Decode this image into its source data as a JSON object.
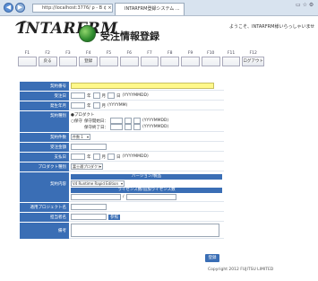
{
  "browser": {
    "address": "http://localhost:3776/",
    "address_suffix": "ρ - B ¢ ×",
    "tab_title": "INTARFRM登録システム ...",
    "tab_close": "×",
    "win_controls": "▭ ☆ ⚙"
  },
  "header": {
    "logo": "INTARFRM",
    "page_title": "受注情報登録",
    "welcome": "ようこそ、INTARFRM様いらっしゃいませ"
  },
  "fkeys": [
    {
      "key": "F1",
      "label": ""
    },
    {
      "key": "F2",
      "label": "戻る"
    },
    {
      "key": "F3",
      "label": ""
    },
    {
      "key": "F4",
      "label": "登録"
    },
    {
      "key": "F5",
      "label": ""
    },
    {
      "key": "F6",
      "label": ""
    },
    {
      "key": "F7",
      "label": ""
    },
    {
      "key": "F8",
      "label": ""
    },
    {
      "key": "F9",
      "label": ""
    },
    {
      "key": "F10",
      "label": ""
    },
    {
      "key": "F11",
      "label": ""
    },
    {
      "key": "F12",
      "label": "ログアウト"
    }
  ],
  "form": {
    "contract_no": {
      "label": "契約番号"
    },
    "order_date": {
      "label": "受注日",
      "year": "年",
      "month": "月",
      "day": "日",
      "format": "(YYYYMMDD)"
    },
    "ym": {
      "label": "発生年月",
      "year": "年",
      "month": "月",
      "format": "(YYYYMM)"
    },
    "contract_type": {
      "label": "契約種別",
      "opt1": "●プロダクト",
      "opt2": "○保守",
      "start_label": "保守開始日：",
      "end_label": "保守終了日：",
      "format": "(YYYYMMDD)"
    },
    "contract_count": {
      "label": "契約件数",
      "value": "件数 1"
    },
    "order_amount": {
      "label": "受注金額"
    },
    "payment_date": {
      "label": "支払日",
      "year": "年",
      "month": "月",
      "day": "日",
      "format": "(YYYYMMDD)"
    },
    "product_type": {
      "label": "プロダクト種別",
      "value": "富士通プロダクト"
    },
    "contract_content": {
      "label": "契約内容",
      "version_hdr": "バージョン/製品",
      "version_value": "V4 Runtime Rapid Edition",
      "license_hdr": "ライセンス数/追加ライセンス数",
      "slash": "/"
    },
    "user_company": {
      "label": "適用プロジェクト名"
    },
    "person": {
      "label": "担当者名",
      "button": "参照"
    },
    "remarks": {
      "label": "備考"
    }
  },
  "footer": {
    "save": "登録",
    "copyright": "Copyright 2012 FUJITSU LIMITED"
  }
}
